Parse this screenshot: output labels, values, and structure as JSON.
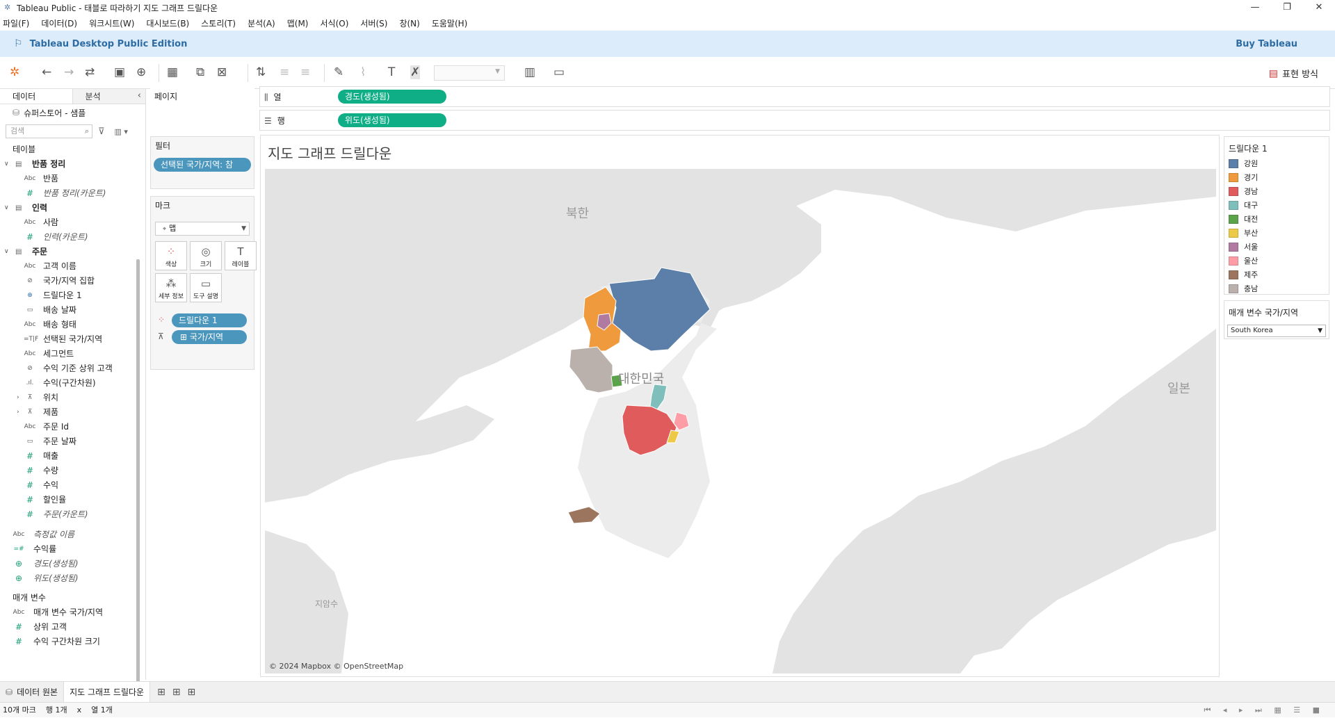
{
  "window": {
    "title": "Tableau Public - 태블로 따라하기 지도 그래프 드릴다운",
    "minimize": "—",
    "maximize": "❐",
    "close": "✕"
  },
  "menu": [
    "파일(F)",
    "데이터(D)",
    "워크시트(W)",
    "대시보드(B)",
    "스토리(T)",
    "분석(A)",
    "맵(M)",
    "서식(O)",
    "서버(S)",
    "창(N)",
    "도움말(H)"
  ],
  "banner": {
    "edition": "Tableau Desktop Public Edition",
    "buy": "Buy Tableau"
  },
  "toolbar": {
    "show_me": "표현 방식"
  },
  "data_pane": {
    "tab_data": "데이터",
    "tab_analysis": "분석",
    "source": "슈퍼스토어 - 샘플",
    "search_placeholder": "검색",
    "tables_header": "테이블",
    "groups": [
      {
        "name": "반품 정리",
        "fields": [
          {
            "type": "Abc",
            "name": "반품"
          },
          {
            "type": "#",
            "name": "반품 정리(카운트)",
            "italic": true
          }
        ]
      },
      {
        "name": "인력",
        "fields": [
          {
            "type": "Abc",
            "name": "사람"
          },
          {
            "type": "#",
            "name": "인력(카운트)",
            "italic": true
          }
        ]
      },
      {
        "name": "주문",
        "fields": [
          {
            "type": "Abc",
            "name": "고객 이름"
          },
          {
            "type": "set",
            "name": "국가/지역 집합"
          },
          {
            "type": "geo",
            "name": "드릴다운 1"
          },
          {
            "type": "date",
            "name": "배송 날짜"
          },
          {
            "type": "Abc",
            "name": "배송 형태"
          },
          {
            "type": "T|F",
            "name": "선택된 국가/지역"
          },
          {
            "type": "Abc",
            "name": "세그먼트"
          },
          {
            "type": "set",
            "name": "수익 기준 상위 고객"
          },
          {
            "type": "bin",
            "name": "수익(구간차원)"
          },
          {
            "type": "hier",
            "name": "위치",
            "expandable": true
          },
          {
            "type": "hier",
            "name": "제품",
            "expandable": true
          },
          {
            "type": "Abc",
            "name": "주문 Id"
          },
          {
            "type": "date",
            "name": "주문 날짜"
          },
          {
            "type": "#",
            "name": "매출"
          },
          {
            "type": "#",
            "name": "수량"
          },
          {
            "type": "#",
            "name": "수익"
          },
          {
            "type": "#",
            "name": "할인율"
          },
          {
            "type": "#",
            "name": "주문(카운트)",
            "italic": true
          }
        ]
      }
    ],
    "extra_fields": [
      {
        "type": "Abc",
        "name": "측정값 이름",
        "italic": true
      },
      {
        "type": "=#",
        "name": "수익률"
      },
      {
        "type": "globe",
        "name": "경도(생성됨)",
        "italic": true
      },
      {
        "type": "globe",
        "name": "위도(생성됨)",
        "italic": true
      }
    ],
    "params_header": "매개 변수",
    "params": [
      {
        "type": "Abc",
        "name": "매개 변수 국가/지역"
      },
      {
        "type": "#",
        "name": "상위 고객"
      },
      {
        "type": "#",
        "name": "수익 구간차원 크기"
      }
    ]
  },
  "cards": {
    "pages": "페이지",
    "filters": "필터",
    "filter_pill": "선택된 국가/지역: 참",
    "marks": "마크",
    "mark_type": "맵",
    "mark_buttons": {
      "color": "색상",
      "size": "크기",
      "label": "레이블",
      "detail": "세부 정보",
      "tooltip": "도구 설명"
    },
    "mark_pill_color": "드릴다운 1",
    "mark_pill_detail": "국가/지역"
  },
  "shelves": {
    "columns_label": "열",
    "columns_pill": "경도(생성됨)",
    "rows_label": "행",
    "rows_pill": "위도(생성됨)"
  },
  "view": {
    "title": "지도 그래프 드릴다운",
    "labels": {
      "north": "북한",
      "south": "대한민국",
      "japan": "일본",
      "island": "지암수"
    },
    "attribution": "© 2024 Mapbox © OpenStreetMap"
  },
  "legend": {
    "title": "드릴다운 1",
    "items": [
      {
        "label": "강원",
        "color": "#5b7fa8"
      },
      {
        "label": "경기",
        "color": "#f09a3e"
      },
      {
        "label": "경남",
        "color": "#e05c5c"
      },
      {
        "label": "대구",
        "color": "#7ebfbc"
      },
      {
        "label": "대전",
        "color": "#5aa34a"
      },
      {
        "label": "부산",
        "color": "#edc948"
      },
      {
        "label": "서울",
        "color": "#b07aa1"
      },
      {
        "label": "울산",
        "color": "#ff9da7"
      },
      {
        "label": "제주",
        "color": "#9c755f"
      },
      {
        "label": "충남",
        "color": "#bab0ac"
      }
    ]
  },
  "parameter": {
    "title": "매개 변수 국가/지역",
    "value": "South Korea"
  },
  "sheet_tabs": {
    "data_source": "데이터 원본",
    "sheet": "지도 그래프 드릴다운"
  },
  "status": {
    "marks": "10개 마크",
    "rows": "행 1개",
    "x": "x",
    "cols": "열 1개"
  }
}
